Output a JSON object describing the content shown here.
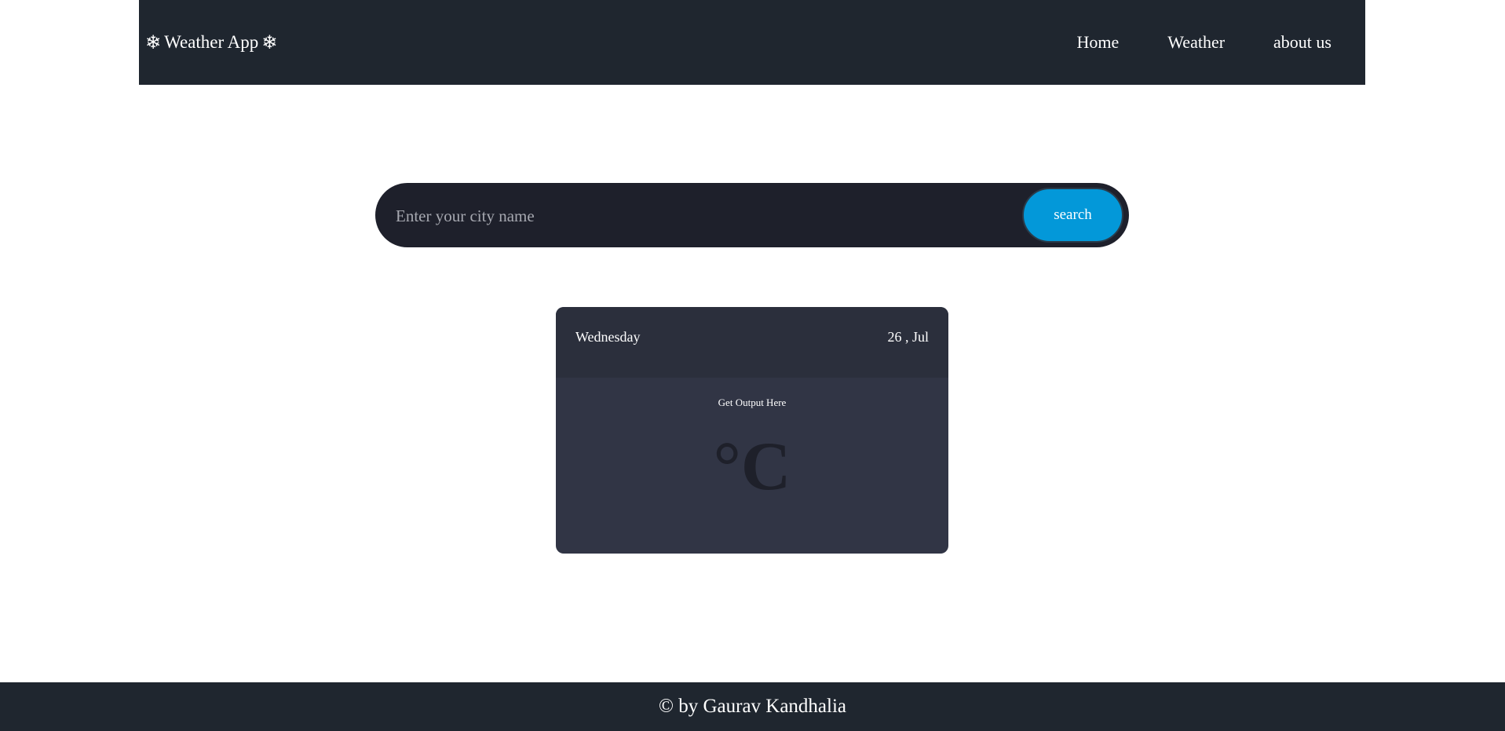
{
  "navbar": {
    "brand": {
      "icon": "❄",
      "icon_name": "snowflake-icon",
      "title": "Weather App"
    },
    "links": [
      {
        "label": "Home"
      },
      {
        "label": "Weather"
      },
      {
        "label": "about us"
      }
    ]
  },
  "search": {
    "placeholder": "Enter your city name",
    "value": "",
    "button_label": "search"
  },
  "weather_card": {
    "day": "Wednesday",
    "date": "26 , Jul",
    "output_text": "Get Output Here",
    "temperature_unit": "°C"
  },
  "footer": {
    "text": "© by Gaurav Kandhalia"
  },
  "colors": {
    "navbar_bg": "#1f262f",
    "search_bar_bg": "#1e202b",
    "search_button": "#0398d9",
    "card_header_bg": "#2b2f3c",
    "card_body_bg": "#313545",
    "footer_bg": "#1f262f"
  }
}
